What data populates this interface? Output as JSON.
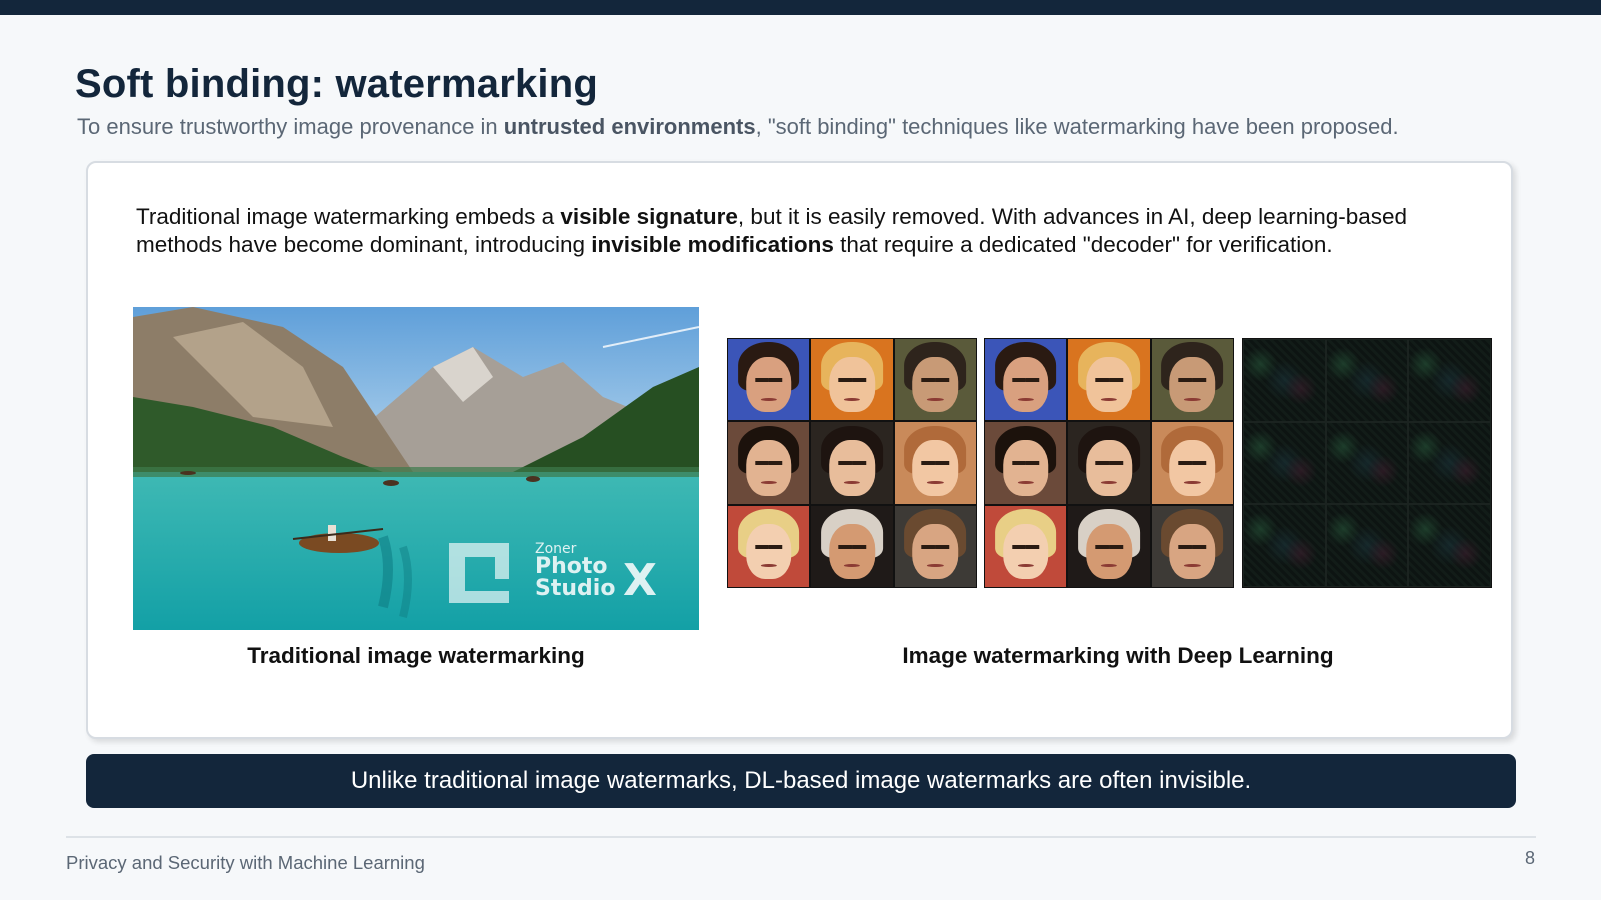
{
  "slide": {
    "title": "Soft binding: watermarking",
    "subtitle": {
      "pre": "To ensure trustworthy image provenance in ",
      "bold": "untrusted environments",
      "post": ", \"soft binding\" techniques like watermarking have been proposed."
    }
  },
  "card": {
    "intro": {
      "part1": "Traditional image watermarking embeds a ",
      "bold1": "visible signature",
      "part2": ", but it is easily removed. With advances in AI, deep learning-based methods have become dominant, introducing ",
      "bold2": "invisible modifications",
      "part3": " that require a dedicated \"decoder\" for verification."
    },
    "left_caption": "Traditional image watermarking",
    "right_caption": "Image watermarking with Deep Learning",
    "watermark_logo": {
      "line1": "Zoner",
      "line2": "Photo",
      "line3": "Studio",
      "mark": "X"
    }
  },
  "banner": {
    "text": "Unlike traditional image watermarks, DL-based image watermarks are often invisible."
  },
  "footer": {
    "course": "Privacy and Security with Machine Learning",
    "page": "8"
  },
  "colors": {
    "navy": "#13263b",
    "subtitle_gray": "#5b6775",
    "lake_teal": "#2aa7a8"
  }
}
